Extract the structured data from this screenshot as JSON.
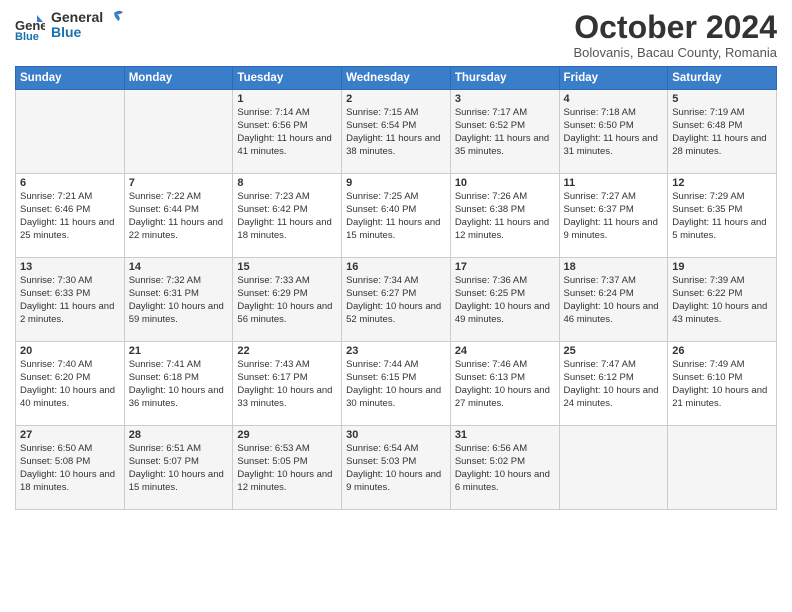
{
  "logo": {
    "line1": "General",
    "line2": "Blue"
  },
  "title": "October 2024",
  "subtitle": "Bolovanis, Bacau County, Romania",
  "days_of_week": [
    "Sunday",
    "Monday",
    "Tuesday",
    "Wednesday",
    "Thursday",
    "Friday",
    "Saturday"
  ],
  "weeks": [
    [
      {
        "day": "",
        "sunrise": "",
        "sunset": "",
        "daylight": ""
      },
      {
        "day": "",
        "sunrise": "",
        "sunset": "",
        "daylight": ""
      },
      {
        "day": "1",
        "sunrise": "Sunrise: 7:14 AM",
        "sunset": "Sunset: 6:56 PM",
        "daylight": "Daylight: 11 hours and 41 minutes."
      },
      {
        "day": "2",
        "sunrise": "Sunrise: 7:15 AM",
        "sunset": "Sunset: 6:54 PM",
        "daylight": "Daylight: 11 hours and 38 minutes."
      },
      {
        "day": "3",
        "sunrise": "Sunrise: 7:17 AM",
        "sunset": "Sunset: 6:52 PM",
        "daylight": "Daylight: 11 hours and 35 minutes."
      },
      {
        "day": "4",
        "sunrise": "Sunrise: 7:18 AM",
        "sunset": "Sunset: 6:50 PM",
        "daylight": "Daylight: 11 hours and 31 minutes."
      },
      {
        "day": "5",
        "sunrise": "Sunrise: 7:19 AM",
        "sunset": "Sunset: 6:48 PM",
        "daylight": "Daylight: 11 hours and 28 minutes."
      }
    ],
    [
      {
        "day": "6",
        "sunrise": "Sunrise: 7:21 AM",
        "sunset": "Sunset: 6:46 PM",
        "daylight": "Daylight: 11 hours and 25 minutes."
      },
      {
        "day": "7",
        "sunrise": "Sunrise: 7:22 AM",
        "sunset": "Sunset: 6:44 PM",
        "daylight": "Daylight: 11 hours and 22 minutes."
      },
      {
        "day": "8",
        "sunrise": "Sunrise: 7:23 AM",
        "sunset": "Sunset: 6:42 PM",
        "daylight": "Daylight: 11 hours and 18 minutes."
      },
      {
        "day": "9",
        "sunrise": "Sunrise: 7:25 AM",
        "sunset": "Sunset: 6:40 PM",
        "daylight": "Daylight: 11 hours and 15 minutes."
      },
      {
        "day": "10",
        "sunrise": "Sunrise: 7:26 AM",
        "sunset": "Sunset: 6:38 PM",
        "daylight": "Daylight: 11 hours and 12 minutes."
      },
      {
        "day": "11",
        "sunrise": "Sunrise: 7:27 AM",
        "sunset": "Sunset: 6:37 PM",
        "daylight": "Daylight: 11 hours and 9 minutes."
      },
      {
        "day": "12",
        "sunrise": "Sunrise: 7:29 AM",
        "sunset": "Sunset: 6:35 PM",
        "daylight": "Daylight: 11 hours and 5 minutes."
      }
    ],
    [
      {
        "day": "13",
        "sunrise": "Sunrise: 7:30 AM",
        "sunset": "Sunset: 6:33 PM",
        "daylight": "Daylight: 11 hours and 2 minutes."
      },
      {
        "day": "14",
        "sunrise": "Sunrise: 7:32 AM",
        "sunset": "Sunset: 6:31 PM",
        "daylight": "Daylight: 10 hours and 59 minutes."
      },
      {
        "day": "15",
        "sunrise": "Sunrise: 7:33 AM",
        "sunset": "Sunset: 6:29 PM",
        "daylight": "Daylight: 10 hours and 56 minutes."
      },
      {
        "day": "16",
        "sunrise": "Sunrise: 7:34 AM",
        "sunset": "Sunset: 6:27 PM",
        "daylight": "Daylight: 10 hours and 52 minutes."
      },
      {
        "day": "17",
        "sunrise": "Sunrise: 7:36 AM",
        "sunset": "Sunset: 6:25 PM",
        "daylight": "Daylight: 10 hours and 49 minutes."
      },
      {
        "day": "18",
        "sunrise": "Sunrise: 7:37 AM",
        "sunset": "Sunset: 6:24 PM",
        "daylight": "Daylight: 10 hours and 46 minutes."
      },
      {
        "day": "19",
        "sunrise": "Sunrise: 7:39 AM",
        "sunset": "Sunset: 6:22 PM",
        "daylight": "Daylight: 10 hours and 43 minutes."
      }
    ],
    [
      {
        "day": "20",
        "sunrise": "Sunrise: 7:40 AM",
        "sunset": "Sunset: 6:20 PM",
        "daylight": "Daylight: 10 hours and 40 minutes."
      },
      {
        "day": "21",
        "sunrise": "Sunrise: 7:41 AM",
        "sunset": "Sunset: 6:18 PM",
        "daylight": "Daylight: 10 hours and 36 minutes."
      },
      {
        "day": "22",
        "sunrise": "Sunrise: 7:43 AM",
        "sunset": "Sunset: 6:17 PM",
        "daylight": "Daylight: 10 hours and 33 minutes."
      },
      {
        "day": "23",
        "sunrise": "Sunrise: 7:44 AM",
        "sunset": "Sunset: 6:15 PM",
        "daylight": "Daylight: 10 hours and 30 minutes."
      },
      {
        "day": "24",
        "sunrise": "Sunrise: 7:46 AM",
        "sunset": "Sunset: 6:13 PM",
        "daylight": "Daylight: 10 hours and 27 minutes."
      },
      {
        "day": "25",
        "sunrise": "Sunrise: 7:47 AM",
        "sunset": "Sunset: 6:12 PM",
        "daylight": "Daylight: 10 hours and 24 minutes."
      },
      {
        "day": "26",
        "sunrise": "Sunrise: 7:49 AM",
        "sunset": "Sunset: 6:10 PM",
        "daylight": "Daylight: 10 hours and 21 minutes."
      }
    ],
    [
      {
        "day": "27",
        "sunrise": "Sunrise: 6:50 AM",
        "sunset": "Sunset: 5:08 PM",
        "daylight": "Daylight: 10 hours and 18 minutes."
      },
      {
        "day": "28",
        "sunrise": "Sunrise: 6:51 AM",
        "sunset": "Sunset: 5:07 PM",
        "daylight": "Daylight: 10 hours and 15 minutes."
      },
      {
        "day": "29",
        "sunrise": "Sunrise: 6:53 AM",
        "sunset": "Sunset: 5:05 PM",
        "daylight": "Daylight: 10 hours and 12 minutes."
      },
      {
        "day": "30",
        "sunrise": "Sunrise: 6:54 AM",
        "sunset": "Sunset: 5:03 PM",
        "daylight": "Daylight: 10 hours and 9 minutes."
      },
      {
        "day": "31",
        "sunrise": "Sunrise: 6:56 AM",
        "sunset": "Sunset: 5:02 PM",
        "daylight": "Daylight: 10 hours and 6 minutes."
      },
      {
        "day": "",
        "sunrise": "",
        "sunset": "",
        "daylight": ""
      },
      {
        "day": "",
        "sunrise": "",
        "sunset": "",
        "daylight": ""
      }
    ]
  ]
}
